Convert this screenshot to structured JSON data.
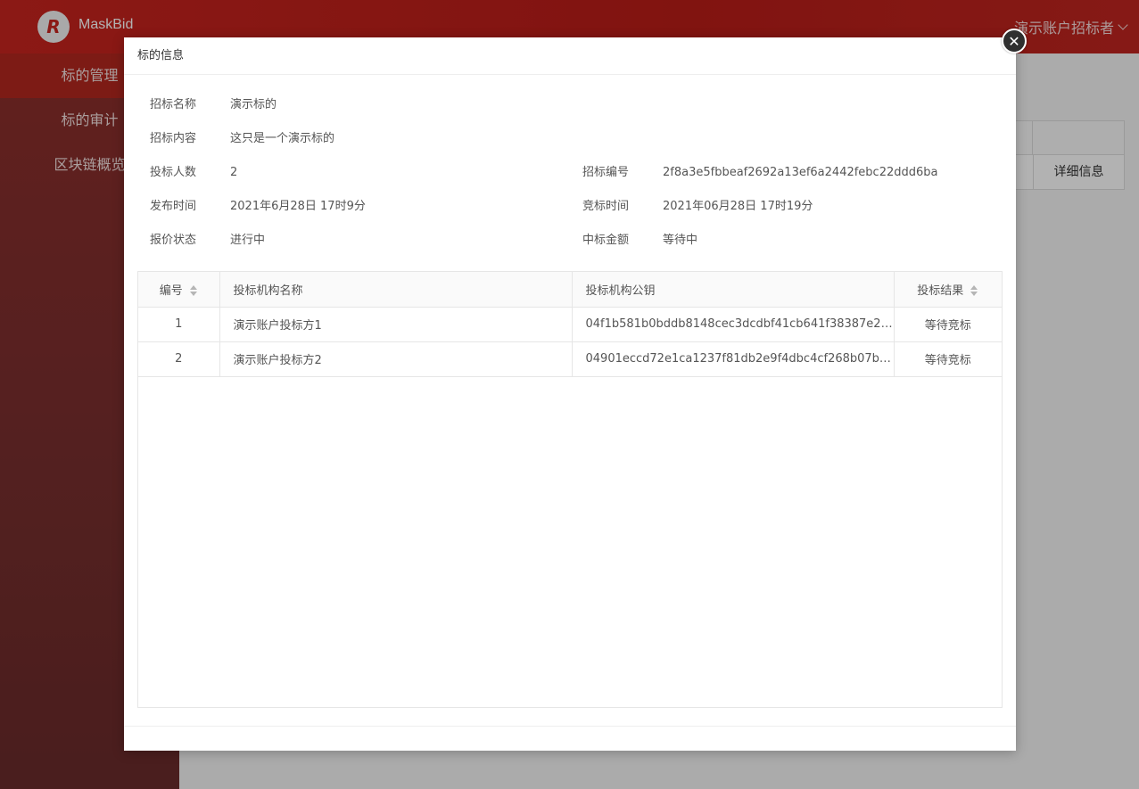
{
  "app": {
    "logo_letter": "R",
    "brand": "MaskBid",
    "user_menu_label": "演示账户招标者"
  },
  "sidebar": {
    "items": [
      {
        "label": "标的管理",
        "active": true
      },
      {
        "label": "标的审计",
        "active": false
      },
      {
        "label": "区块链概览",
        "active": false
      }
    ]
  },
  "background_table": {
    "visible_cell": "详细信息"
  },
  "modal": {
    "title": "标的信息",
    "close_icon": "close-icon",
    "fields": {
      "tender_name_label": "招标名称",
      "tender_name": "演示标的",
      "tender_content_label": "招标内容",
      "tender_content": "这只是一个演示标的",
      "bidder_count_label": "投标人数",
      "bidder_count": "2",
      "tender_id_label": "招标编号",
      "tender_id": "2f8a3e5fbbeaf2692a13ef6a2442febc22ddd6ba",
      "publish_time_label": "发布时间",
      "publish_time": "2021年6月28日 17时9分",
      "bid_time_label": "竞标时间",
      "bid_time": "2021年06月28日 17时19分",
      "quote_status_label": "报价状态",
      "quote_status": "进行中",
      "winning_amount_label": "中标金额",
      "winning_amount": "等待中"
    },
    "table": {
      "headers": {
        "number": "编号",
        "name": "投标机构名称",
        "key": "投标机构公钥",
        "result": "投标结果"
      },
      "rows": [
        {
          "number": "1",
          "name": "演示账户投标方1",
          "key": "04f1b581b0bddb8148cec3dcdbf41cb641f38387e2…",
          "result": "等待竞标"
        },
        {
          "number": "2",
          "name": "演示账户投标方2",
          "key": "04901eccd72e1ca1237f81db2e9f4dbc4cf268b07b…",
          "result": "等待竞标"
        }
      ]
    }
  },
  "colors": {
    "header_red": "#c8241f",
    "sidebar_active": "#b4271f",
    "sidebar_bg": "#7a2f2e"
  }
}
